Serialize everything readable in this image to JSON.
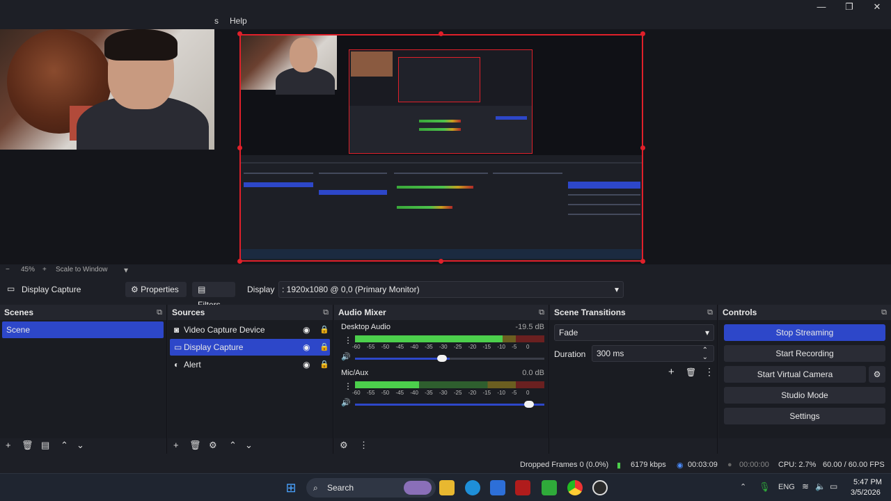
{
  "window": {
    "minimize": "—",
    "maximize": "❐",
    "close": "✕"
  },
  "menu": {
    "partial_item": "s",
    "help": "Help"
  },
  "zoom": {
    "minus": "−",
    "level": "45%",
    "plus": "+",
    "mode": "Scale to Window",
    "caret": "▾"
  },
  "source_toolbar": {
    "current_source": "Display Capture",
    "properties": "Properties",
    "filters": "Filters",
    "display_label": "Display",
    "display_value": ": 1920x1080 @ 0,0 (Primary Monitor)"
  },
  "scenes": {
    "title": "Scenes",
    "items": [
      "Scene"
    ],
    "selected": "Scene"
  },
  "sources": {
    "title": "Sources",
    "items": [
      {
        "name": "Video Capture Device",
        "icon": "camera-icon"
      },
      {
        "name": "Display Capture",
        "icon": "monitor-icon"
      },
      {
        "name": "Alert",
        "icon": "browser-icon"
      }
    ],
    "selected": "Display Capture"
  },
  "audio_mixer": {
    "title": "Audio Mixer",
    "channels": [
      {
        "name": "Desktop Audio",
        "db": "-19.5 dB",
        "level": 0.78,
        "volume": 0.5
      },
      {
        "name": "Mic/Aux",
        "db": "0.0 dB",
        "level": 0.34,
        "volume": 1.0
      }
    ],
    "scale": [
      "-60",
      "-55",
      "-50",
      "-45",
      "-40",
      "-35",
      "-30",
      "-25",
      "-20",
      "-15",
      "-10",
      "-5",
      "0"
    ]
  },
  "transitions": {
    "title": "Scene Transitions",
    "type": "Fade",
    "duration_label": "Duration",
    "duration_value": "300 ms"
  },
  "controls": {
    "title": "Controls",
    "stop_streaming": "Stop Streaming",
    "start_recording": "Start Recording",
    "start_virtual_camera": "Start Virtual Camera",
    "studio_mode": "Studio Mode",
    "settings": "Settings"
  },
  "status": {
    "dropped_frames": "Dropped Frames 0 (0.0%)",
    "bitrate": "6179 kbps",
    "stream_time": "00:03:09",
    "rec_time": "00:00:00",
    "cpu": "CPU: 2.7%",
    "fps": "60.00 / 60.00 FPS"
  },
  "taskbar": {
    "search": "Search",
    "lang": "ENG",
    "time": "5:47 PM",
    "date": "3/5/2026"
  },
  "colors": {
    "accent": "#2d47c9",
    "selection_border": "#e0202a",
    "bg": "#1d1f26"
  }
}
